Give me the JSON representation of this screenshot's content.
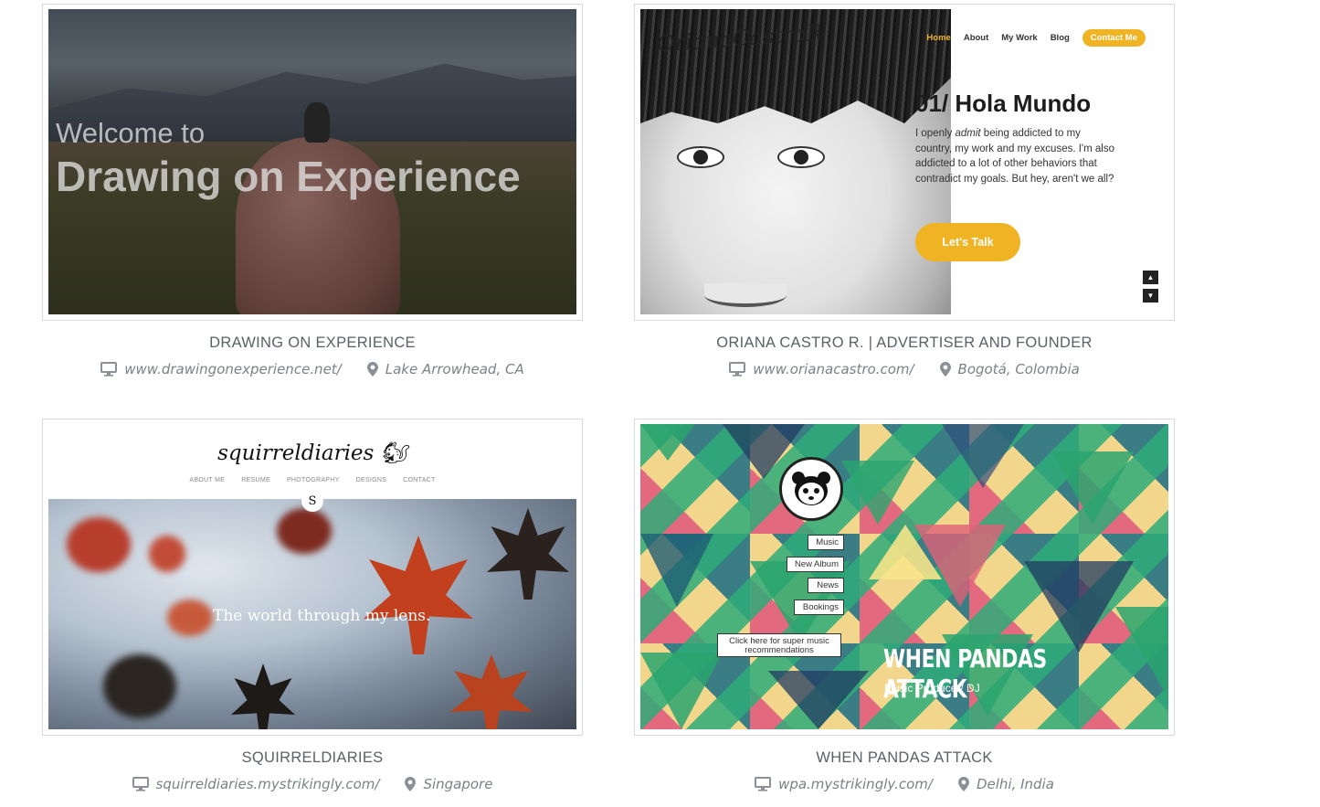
{
  "cards": [
    {
      "title": "DRAWING ON EXPERIENCE",
      "url": "www.drawingonexperience.net/",
      "location": "Lake Arrowhead, CA",
      "preview": {
        "welcome": "Welcome to",
        "headline": "Drawing on Experience"
      }
    },
    {
      "title": "ORIANA CASTRO R. | ADVERTISER AND FOUNDER",
      "url": "www.orianacastro.com/",
      "location": "Bogotá, Colombia",
      "preview": {
        "signature": "OrianaCastroR",
        "nav": [
          "Home",
          "About",
          "My Work",
          "Blog",
          "Contact Me"
        ],
        "heading": "01/ Hola Mundo",
        "body_pre": "I openly ",
        "body_em": "admit",
        "body_post": " being addicted to my country, my work and my excuses. I'm also addicted to a lot of other behaviors that contradict my goals. But hey, aren't we all?",
        "button": "Let's Talk",
        "arrow_up": "▲",
        "arrow_down": "▼"
      }
    },
    {
      "title": "SQUIRRELDIARIES",
      "url": "squirreldiaries.mystrikingly.com/",
      "location": "Singapore",
      "preview": {
        "logo": "squirreldiaries",
        "nav": [
          "ABOUT ME",
          "RESUME",
          "PHOTOGRAPHY",
          "DESIGNS",
          "CONTACT"
        ],
        "badge": "S",
        "tagline": "The world through my lens."
      }
    },
    {
      "title": "WHEN PANDAS ATTACK",
      "url": "wpa.mystrikingly.com/",
      "location": "Delhi, India",
      "preview": {
        "menu": [
          "Music",
          "New Album",
          "News",
          "Bookings"
        ],
        "cta": "Click here for super music recommendations",
        "heading": "WHEN PANDAS ATTACK",
        "subheading": "Music Producer/ DJ"
      }
    }
  ],
  "icons": {
    "url": "monitor-icon",
    "location": "map-pin-icon"
  },
  "colors": {
    "accent_yellow": "#f0b323",
    "text_gray": "#5b6166"
  }
}
